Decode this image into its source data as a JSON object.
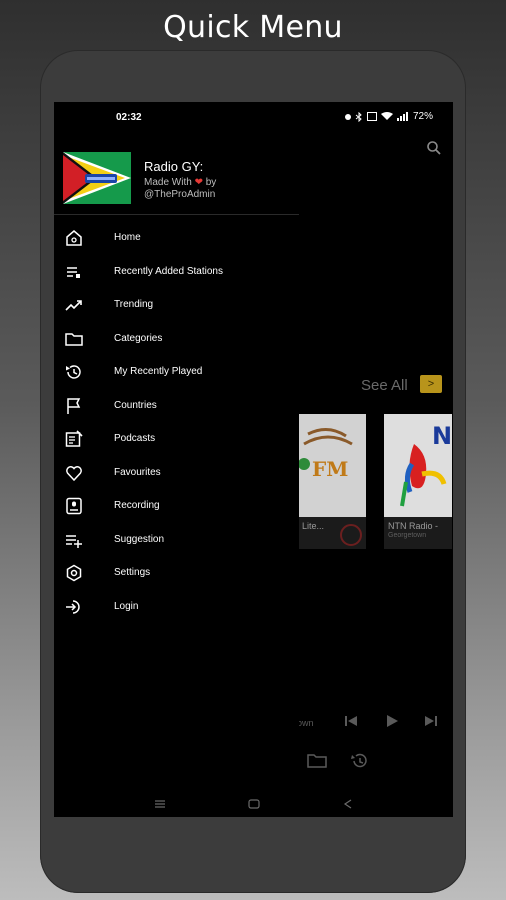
{
  "heading": "Quick Menu",
  "status": {
    "time": "02:32",
    "battery": "72%"
  },
  "drawer": {
    "app_name": "Radio GY:",
    "tagline_prefix": "Made With",
    "tagline_suffix": "by",
    "tagline_handle": "@TheProAdmin",
    "items": [
      {
        "label": "Home",
        "icon": "home-icon"
      },
      {
        "label": "Recently Added Stations",
        "icon": "playlist-add-icon"
      },
      {
        "label": "Trending",
        "icon": "trending-up-icon"
      },
      {
        "label": "Categories",
        "icon": "folder-icon"
      },
      {
        "label": "My Recently Played",
        "icon": "history-icon"
      },
      {
        "label": "Countries",
        "icon": "flag-icon"
      },
      {
        "label": "Podcasts",
        "icon": "podcast-icon"
      },
      {
        "label": "Favourites",
        "icon": "heart-icon"
      },
      {
        "label": "Recording",
        "icon": "recording-icon"
      },
      {
        "label": "Suggestion",
        "icon": "playlist-plus-icon"
      },
      {
        "label": "Settings",
        "icon": "settings-icon"
      },
      {
        "label": "Login",
        "icon": "login-icon"
      }
    ]
  },
  "background": {
    "see_all": "See All",
    "see_all_arrow": ">",
    "cards": [
      {
        "title": "Lite...",
        "subtitle": ""
      },
      {
        "title": "NTN Radio -",
        "subtitle": "Georgetown"
      }
    ],
    "player_text": "own"
  },
  "colors": {
    "accent": "#b8941b",
    "heart": "#e53935",
    "drawer_bg": "#000000"
  }
}
